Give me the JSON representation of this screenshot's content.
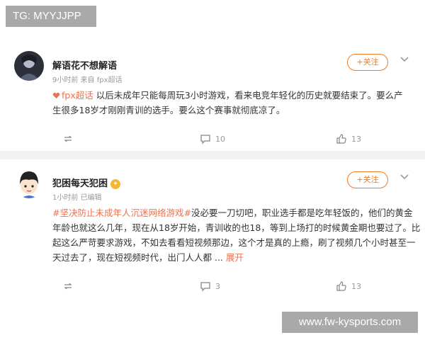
{
  "overlay": {
    "tg_label": "TG: MYYJJPP",
    "watermark": "www.fw-kysports.com"
  },
  "posts": [
    {
      "username": "解语花不想解语",
      "meta": "9小时前 来自 fpx超话",
      "follow_label": "+关注",
      "hashtag": "fpx超话",
      "content": " 以后未成年只能每周玩3小时游戏，看来电竞年轻化的历史就要结束了。要么产生很多18岁才刚刚青训的选手。要么这个赛事就彻底凉了。",
      "repost_count": "",
      "comment_count": "10",
      "like_count": "13"
    },
    {
      "username": "犯困每天犯困",
      "meta": "1小时前  已编辑",
      "follow_label": "+关注",
      "hashtag": "#坚决防止未成年人沉迷网络游戏#",
      "content": "没必要一刀切吧，职业选手都是吃年轻饭的，他们的黄金年龄也就这么几年，现在从18岁开始，青训收的也18，等到上场打的时候黄金期也要过了。比起这么严苛要求游戏，不如去看看短视频那边，这个才是真的上瘾，刷了视频几个小时甚至一天过去了，现在短视频时代，出门人人都 ...",
      "expand_label": "展开",
      "repost_count": "",
      "comment_count": "3",
      "like_count": "13"
    }
  ],
  "colors": {
    "accent": "#eb7350",
    "follow": "#f07a22",
    "meta_text": "#999999"
  }
}
